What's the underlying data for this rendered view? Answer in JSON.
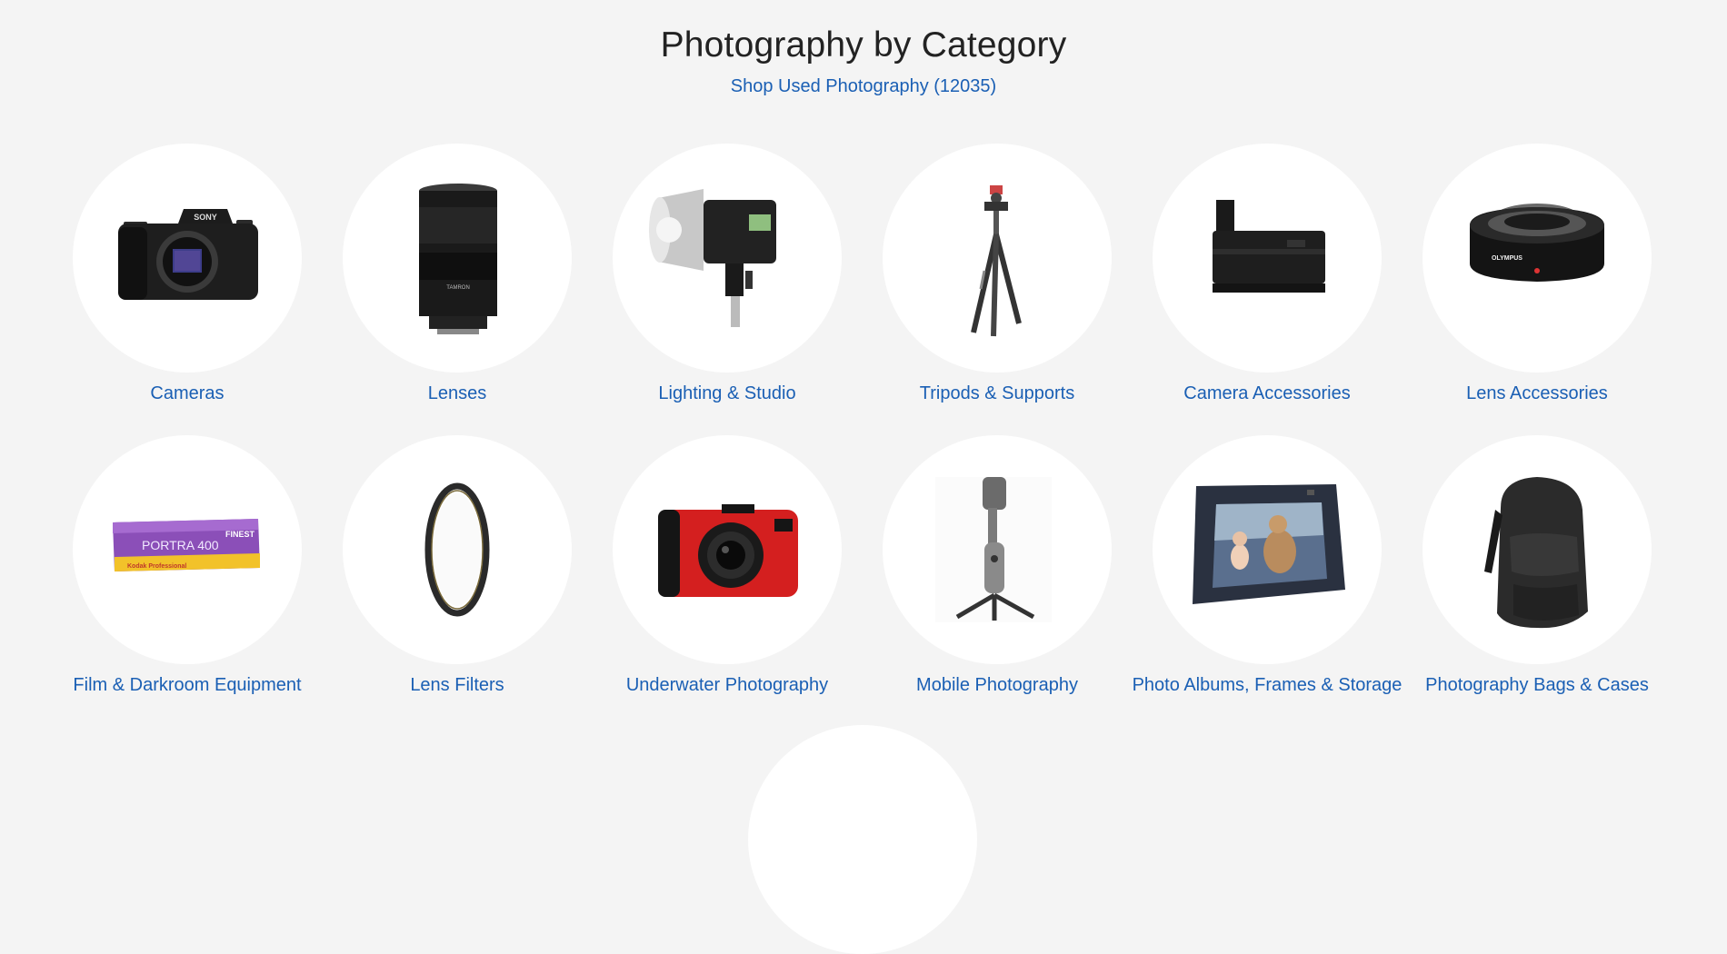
{
  "page": {
    "title": "Photography by Category",
    "shop_link": "Shop Used Photography (12035)"
  },
  "categories": [
    {
      "label": "Cameras",
      "icon": "mirrorless-camera-icon"
    },
    {
      "label": "Lenses",
      "icon": "zoom-lens-icon"
    },
    {
      "label": "Lighting & Studio",
      "icon": "studio-flash-icon"
    },
    {
      "label": "Tripods & Supports",
      "icon": "tripod-icon"
    },
    {
      "label": "Camera Accessories",
      "icon": "battery-grip-icon"
    },
    {
      "label": "Lens Accessories",
      "icon": "teleconverter-icon"
    },
    {
      "label": "Film & Darkroom Equipment",
      "icon": "film-box-icon"
    },
    {
      "label": "Lens Filters",
      "icon": "filter-ring-icon"
    },
    {
      "label": "Underwater Photography",
      "icon": "rugged-camera-icon"
    },
    {
      "label": "Mobile Photography",
      "icon": "phone-gimbal-icon"
    },
    {
      "label": "Photo Albums, Frames & Storage",
      "icon": "digital-frame-icon"
    },
    {
      "label": "Photography Bags & Cases",
      "icon": "camera-backpack-icon"
    }
  ],
  "product_text": {
    "camera_brand": "SONY",
    "lens_brand": "TAMRON",
    "teleconverter_brand": "OLYMPUS",
    "film_name": "PORTRA 400",
    "film_brand": "Kodak Professional",
    "film_tag": "FINEST"
  },
  "colors": {
    "background": "#f4f4f4",
    "link": "#1a5fb4",
    "heading": "#222222",
    "circle": "#ffffff"
  }
}
